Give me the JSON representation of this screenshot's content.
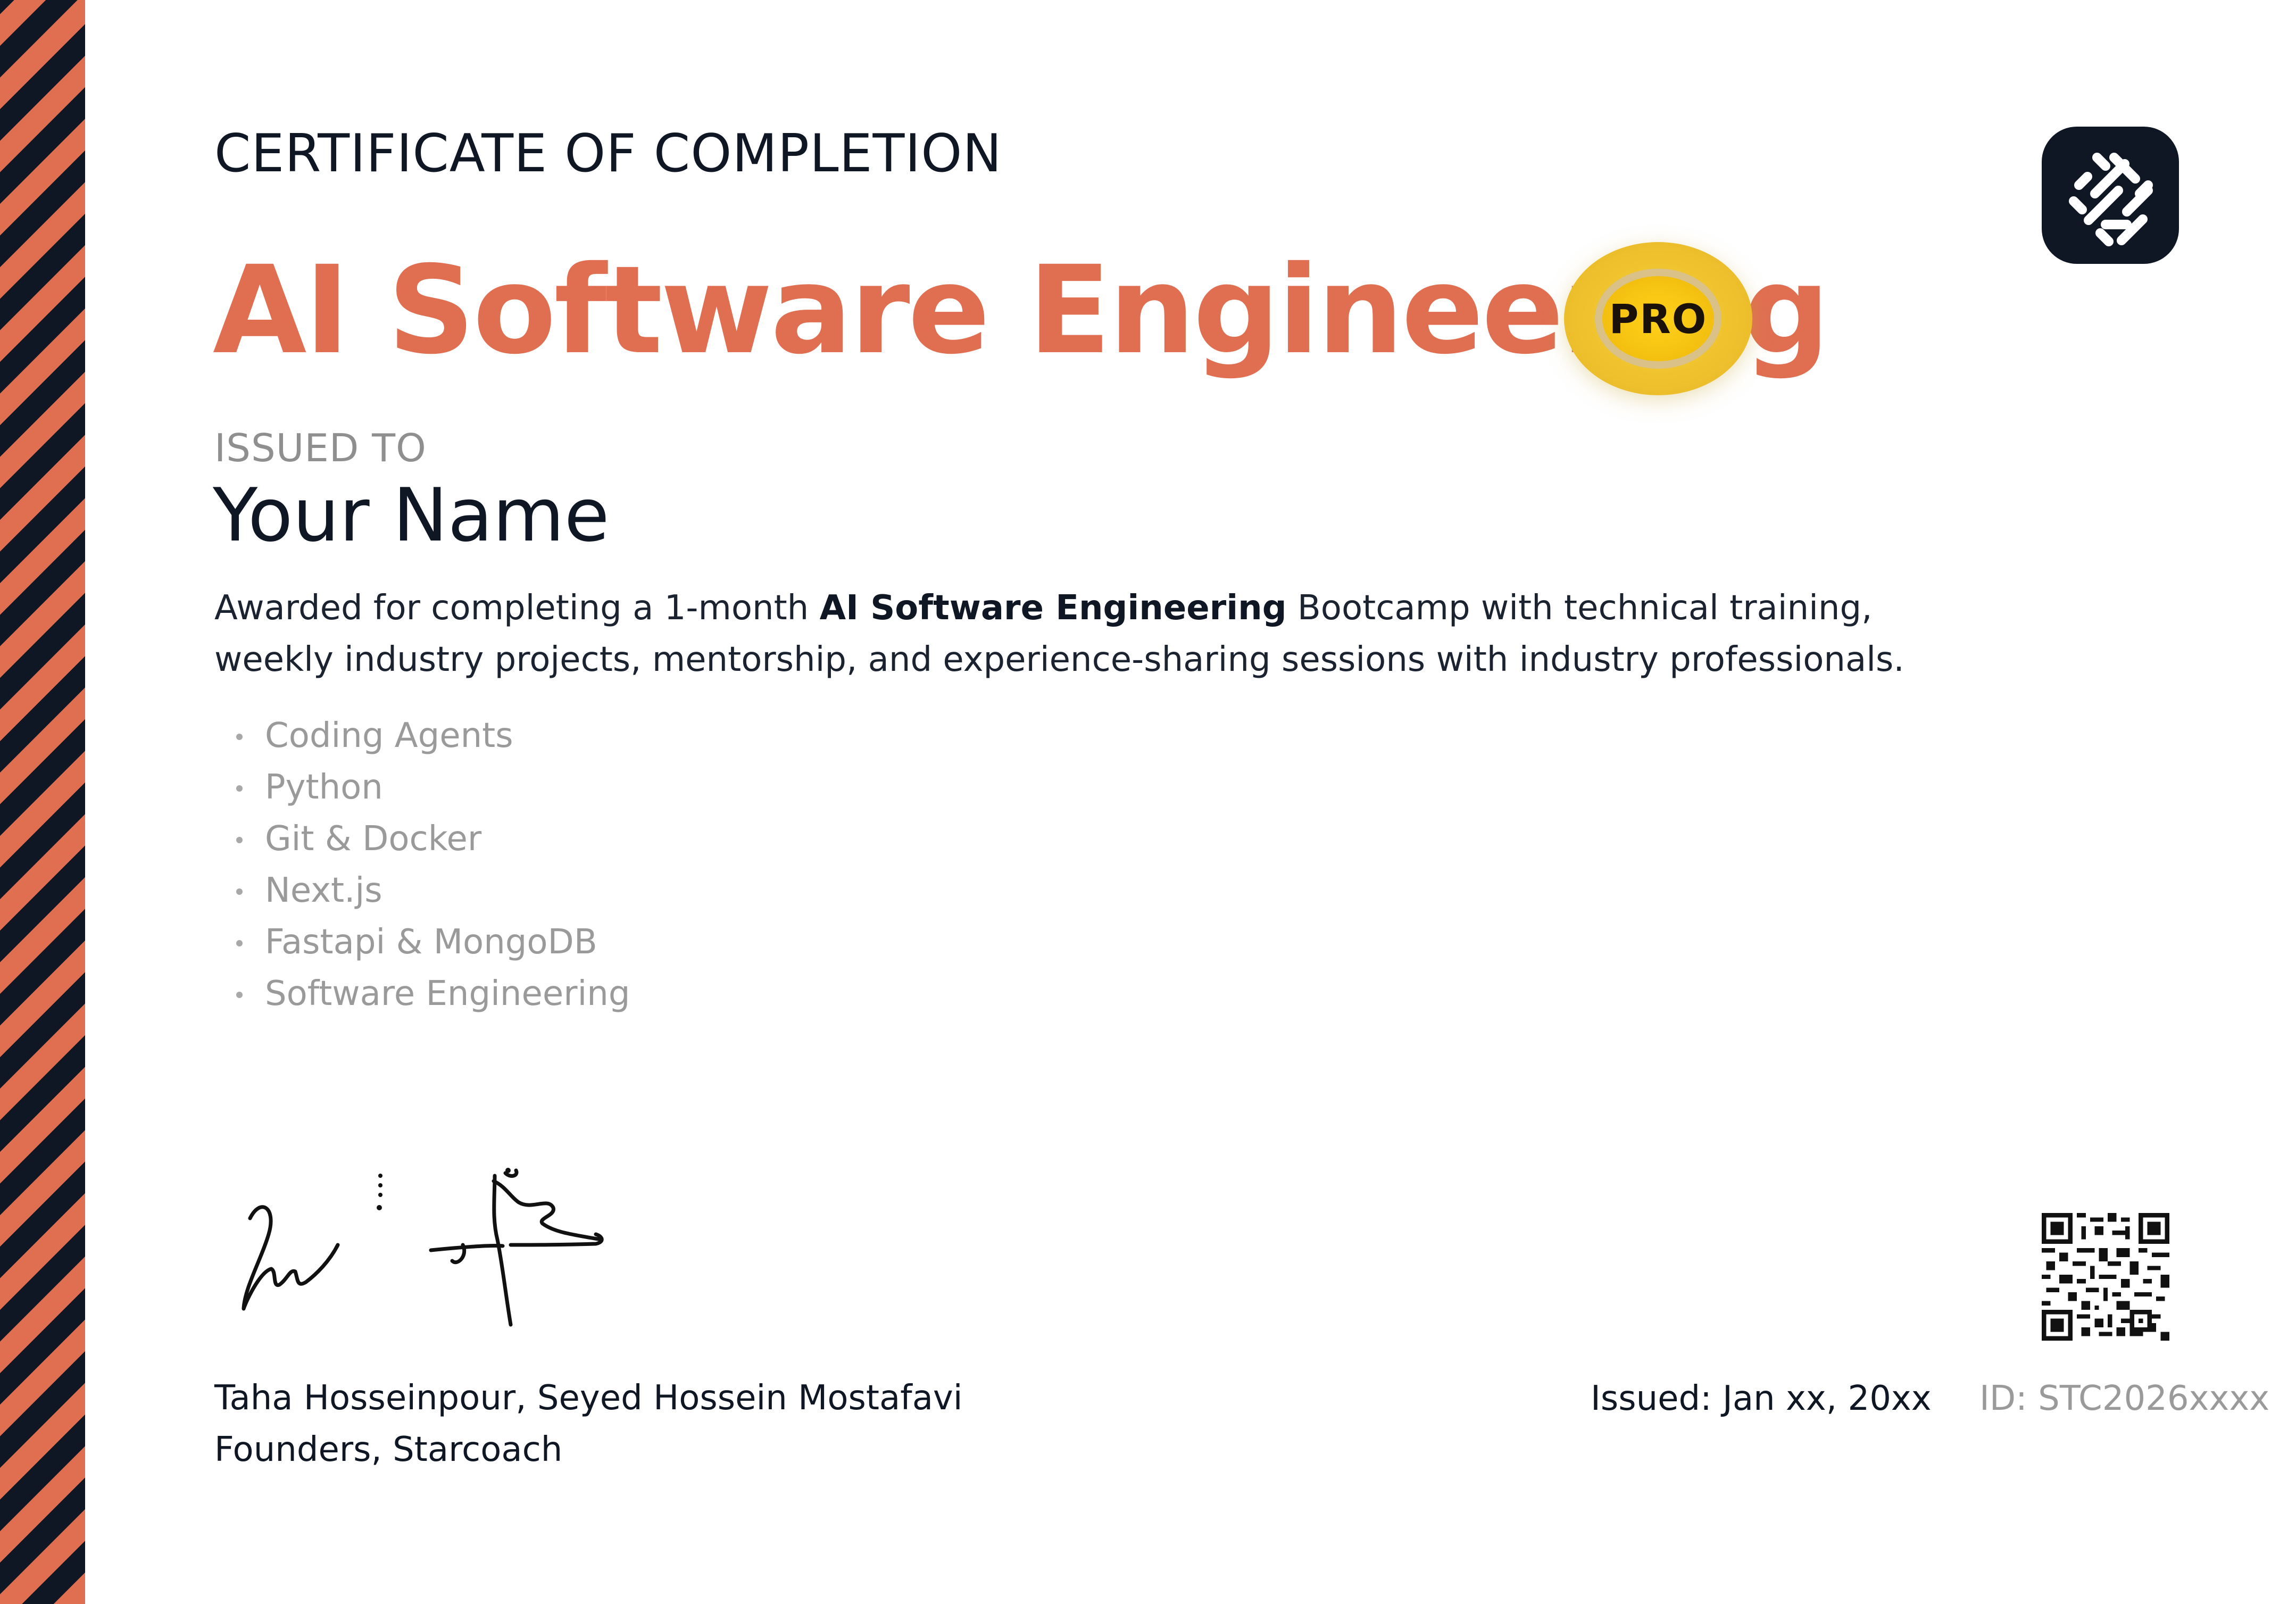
{
  "certificate": {
    "heading": "CERTIFICATE OF COMPLETION",
    "course_title": "AI Software Engineering",
    "badge": "PRO",
    "issued_to_label": "ISSUED TO",
    "recipient_name": "Your Name",
    "description_prefix": "Awarded for completing a 1-month ",
    "description_bold": "AI Software Engineering",
    "description_suffix": " Bootcamp with technical training, weekly industry projects, mentorship, and experience-sharing sessions with industry professionals.",
    "skills": [
      "Coding Agents",
      "Python",
      "Git & Docker",
      "Next.js",
      "Fastapi & MongoDB",
      "Software Engineering"
    ],
    "founders_line1": "Taha Hosseinpour, Seyed Hossein Mostafavi",
    "founders_line2": "Founders, Starcoach",
    "issued_date": "Issued: Jan xx, 20xx",
    "certificate_id": "ID: STC2026xxxx"
  },
  "colors": {
    "accent": "#e06f52",
    "dark": "#0f1624",
    "muted": "#9a9a9a",
    "badge_gold": "#f3c01d"
  },
  "icons": {
    "logo": "starcoach-logo-icon",
    "qr": "qr-code-icon"
  }
}
